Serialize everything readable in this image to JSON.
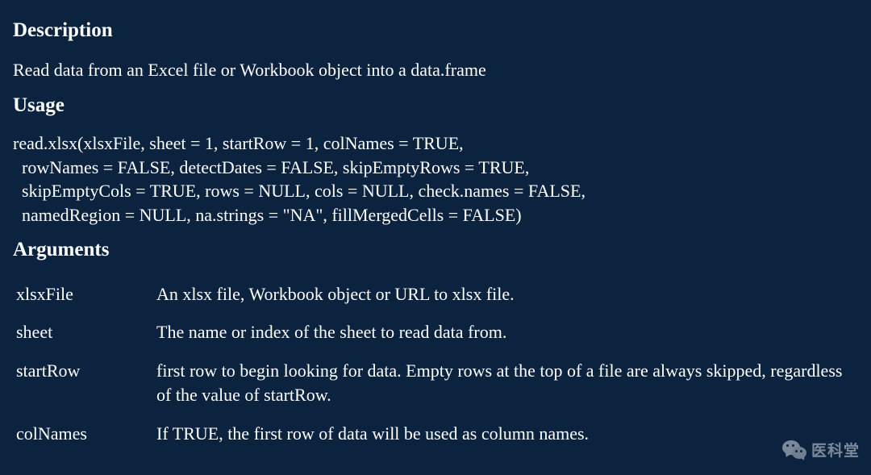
{
  "sections": {
    "description": {
      "heading": "Description",
      "text": "Read data from an Excel file or Workbook object into a data.frame"
    },
    "usage": {
      "heading": "Usage",
      "code": "read.xlsx(xlsxFile, sheet = 1, startRow = 1, colNames = TRUE,\n  rowNames = FALSE, detectDates = FALSE, skipEmptyRows = TRUE,\n  skipEmptyCols = TRUE, rows = NULL, cols = NULL, check.names = FALSE,\n  namedRegion = NULL, na.strings = \"NA\", fillMergedCells = FALSE)"
    },
    "arguments": {
      "heading": "Arguments",
      "items": [
        {
          "name": "xlsxFile",
          "desc": "An xlsx file, Workbook object or URL to xlsx file."
        },
        {
          "name": "sheet",
          "desc": "The name or index of the sheet to read data from."
        },
        {
          "name": "startRow",
          "desc": "first row to begin looking for data. Empty rows at the top of a file are always skipped, regardless of the value of startRow."
        },
        {
          "name": "colNames",
          "desc": "If TRUE, the first row of data will be used as column names."
        }
      ]
    }
  },
  "watermark": {
    "label": "医科堂"
  }
}
